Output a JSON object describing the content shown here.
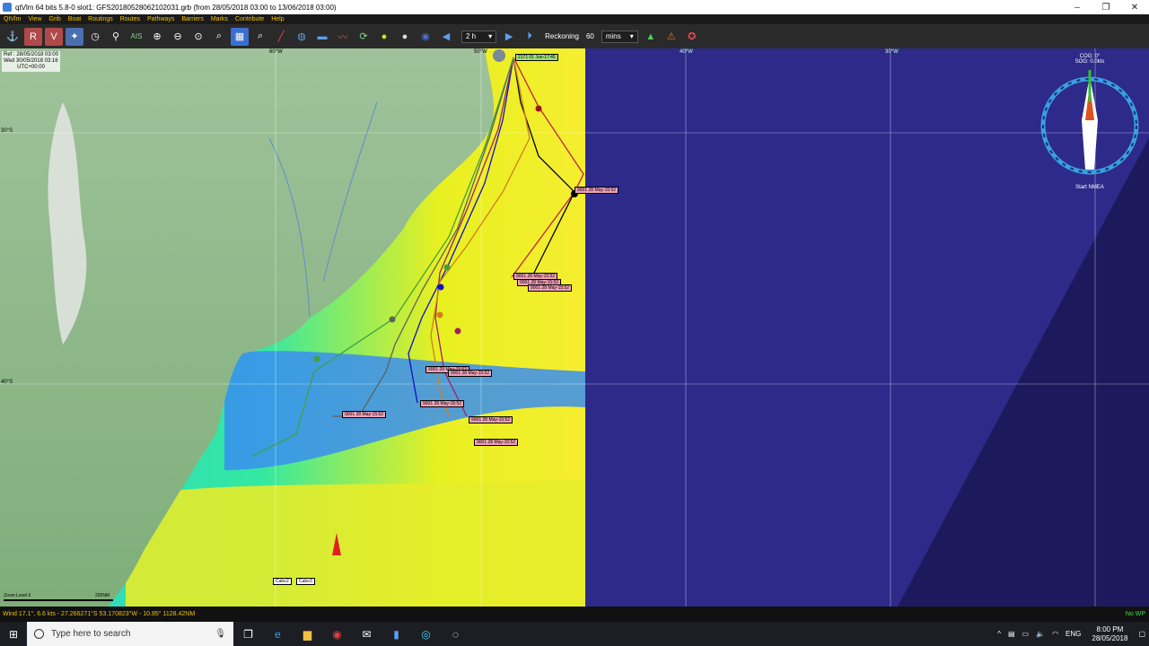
{
  "window": {
    "title": "qtVlm 64 bits 5.8-0 slot1: GFS20180528062102031.grb (from 28/05/2018 03:00 to 13/06/2018 03:00)"
  },
  "menu": [
    "QtVlm",
    "View",
    "Grib",
    "Boat",
    "Routings",
    "Routes",
    "Pathways",
    "Barriers",
    "Marks",
    "Contribute",
    "Help"
  ],
  "toolbar": {
    "step_value": "2 h",
    "reckoning_label": "Reckoning",
    "reckoning_value": "60",
    "unit_value": "mins"
  },
  "map": {
    "ref_line1": "Ref : 28/05/2018 03:00",
    "ref_line2": "Wed 30/05/2018 03:16",
    "ref_line3": "UTC+00:00",
    "lon_labels": [
      "60°W",
      "50°W",
      "40°W",
      "30°W"
    ],
    "lat_labels": [
      "30°S",
      "40°S"
    ],
    "top_tag": "2171 01 Jun-17:45",
    "mid_tag": "9001 28 May-15:52",
    "eta_tags": [
      "9001 28 May-15:52",
      "9001 28 May-15:52",
      "9001 28 May-15:52",
      "9001 28 May-15:52",
      "9001 28 May-15:52",
      "9001 28 May-15:52",
      "9001 28 May-15:52",
      "9001 28 May-15:52",
      "9001 28 May-15:52"
    ],
    "small_tags": [
      "Cabo2",
      "Cabo3"
    ],
    "scale_left": "Zoom Level 6",
    "scale_right": "200NM"
  },
  "compass": {
    "cog": "COG: 0°",
    "sog": "SOG: 0.0kts",
    "nmea": "Start NMEA"
  },
  "status": {
    "left": "Wind 17.1°, 6.6 kts   -   27.266271°S 53.170823°W  -  10.85° 1128.42NM",
    "right": "No WP"
  },
  "taskbar": {
    "search_placeholder": "Type here to search",
    "time": "8:00 PM",
    "date": "28/05/2018",
    "lang": "ENG"
  },
  "colors": {
    "ocean_dark": "#2d2a8a",
    "menu_text": "#f2c200"
  }
}
